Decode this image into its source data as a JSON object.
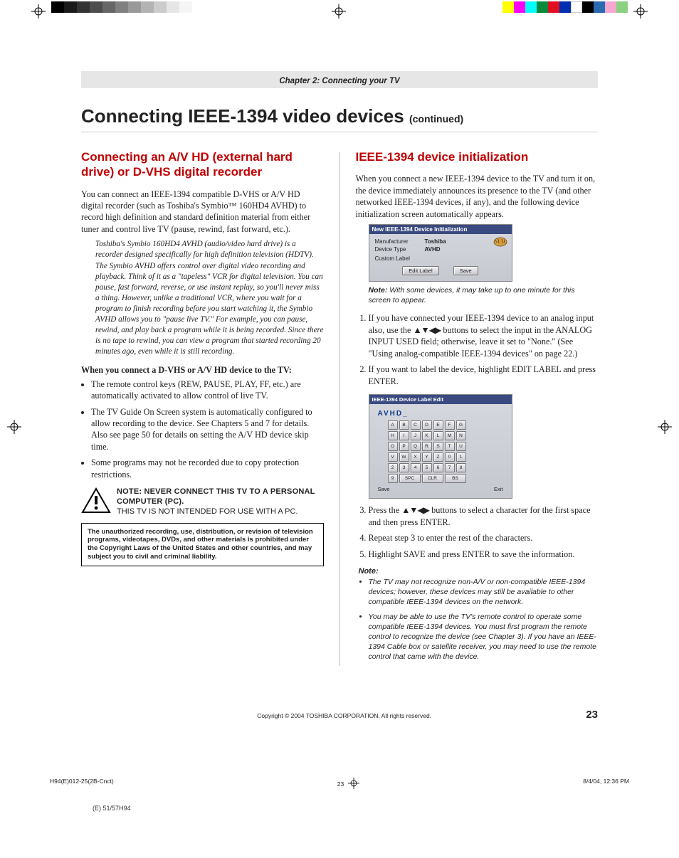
{
  "chapter_band": "Chapter 2: Connecting your TV",
  "page_title": "Connecting IEEE-1394 video devices",
  "page_title_cont": "(continued)",
  "left": {
    "h2": "Connecting an A/V HD (external hard drive) or D-VHS digital recorder",
    "p1": "You can connect an IEEE-1394 compatible D-VHS or A/V HD digital recorder (such as Toshiba's Symbio™ 160HD4 AVHD) to record high definition and standard definition material from either tuner and control live TV (pause, rewind, fast forward, etc.).",
    "italic": "Toshiba's Symbio 160HD4 AVHD (audio/video hard drive) is a recorder designed specifically for high definition television (HDTV). The Symbio AVHD offers control over digital video recording and playback. Think of it as a \"tapeless\" VCR for digital television. You can pause, fast forward, reverse, or use instant replay, so you'll never miss a thing. However, unlike a traditional VCR, where you wait for a program to finish recording before you start watching it, the Symbio AVHD allows you to \"pause live TV.\"  For example, you can pause, rewind, and play back a program while it is being recorded. Since there is no tape to rewind, you can view a program that started recording 20 minutes ago, even while it is still recording.",
    "lead": "When you connect a D-VHS or A/V HD device to the TV:",
    "bul1": "The remote control keys (REW, PAUSE, PLAY, FF, etc.) are automatically activated to allow control of live TV.",
    "bul2": "The TV Guide On Screen system is automatically configured to allow recording to the device. See Chapters 5 and 7 for details. Also see page 50 for details on setting the A/V HD device skip time.",
    "bul3": "Some programs may not be recorded due to copy protection restrictions.",
    "warn_line1": "NOTE: NEVER CONNECT THIS TV TO A PERSONAL COMPUTER (PC).",
    "warn_line2": "THIS TV IS NOT INTENDED FOR USE WITH A PC.",
    "legal": "The unauthorized recording, use, distribution, or revision of television programs, videotapes, DVDs, and other materials is prohibited under the Copyright Laws of the United States and other countries, and may subject you to civil and criminal liability."
  },
  "right": {
    "h2": "IEEE-1394 device initialization",
    "intro": "When you connect a new IEEE-1394 device to the TV and turn it on, the device immediately announces its presence to the TV (and other networked IEEE-1394 devices, if any), and the following device initialization screen automatically appears.",
    "panel1": {
      "title": "New IEEE-1394 Device Initialization",
      "manufacturer_k": "Manufacturer",
      "manufacturer_v": "Toshiba",
      "device_type_k": "Device Type",
      "device_type_v": "AVHD",
      "custom_label": "Custom Label",
      "btn_edit": "Edit Label",
      "btn_save": "Save"
    },
    "note1_label": "Note:",
    "note1": "With some devices, it may take up to one minute for this screen to appear.",
    "step1a": "If you have connected your IEEE-1394 device to an analog input also, use the ",
    "step1b": " buttons to select the input in the ANALOG INPUT USED field; otherwise, leave it set to \"None.\" (See \"Using analog-compatible IEEE-1394 devices\" on page 22.)",
    "step2": "If you want to label the device, highlight EDIT LABEL and press ENTER.",
    "panel2": {
      "title": "IEEE-1394 Device Label Edit",
      "field": "AVHD_",
      "rows": [
        [
          "A",
          "B",
          "C",
          "D",
          "E",
          "F",
          "G"
        ],
        [
          "H",
          "I",
          "J",
          "K",
          "L",
          "M",
          "N"
        ],
        [
          "O",
          "P",
          "Q",
          "R",
          "S",
          "T",
          "U"
        ],
        [
          "V",
          "W",
          "X",
          "Y",
          "Z",
          "0",
          "1"
        ],
        [
          "2",
          "3",
          "4",
          "5",
          "6",
          "7",
          "8"
        ]
      ],
      "lastrow": [
        "9",
        "SPC",
        "CLR",
        "BS"
      ],
      "btn_save": "Save",
      "btn_exit": "Exit"
    },
    "step3a": "Press the ",
    "step3b": " buttons to select a character for the first space and then press ENTER.",
    "step4": "Repeat step 3 to enter the rest of the characters.",
    "step5": "Highlight SAVE and press ENTER to save the information.",
    "note_head": "Note:",
    "nb1": "The TV may not recognize non-A/V or non-compatible IEEE-1394 devices; however, these devices may still be available to other compatible IEEE-1394 devices on the network.",
    "nb2": "You may be able to use the TV's remote control to operate some compatible IEEE-1394 devices. You must first program the remote control to recognize the device (see Chapter 3). If you have an IEEE-1394 Cable box or satellite receiver, you may need to use the remote control that came with the device."
  },
  "footer": {
    "copyright": "Copyright © 2004 TOSHIBA CORPORATION. All rights reserved.",
    "page_number": "23"
  },
  "slug": {
    "file": "H94(E)012-25(2B-Cnct)",
    "pg": "23",
    "date": "8/4/04, 12:36 PM"
  },
  "bottom_tag": "(E) 51/57H94"
}
